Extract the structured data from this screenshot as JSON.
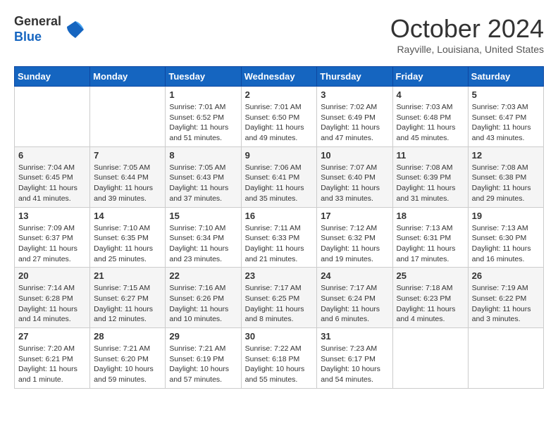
{
  "logo": {
    "general": "General",
    "blue": "Blue"
  },
  "header": {
    "month_title": "October 2024",
    "location": "Rayville, Louisiana, United States"
  },
  "weekdays": [
    "Sunday",
    "Monday",
    "Tuesday",
    "Wednesday",
    "Thursday",
    "Friday",
    "Saturday"
  ],
  "weeks": [
    [
      {
        "day": "",
        "info": ""
      },
      {
        "day": "",
        "info": ""
      },
      {
        "day": "1",
        "info": "Sunrise: 7:01 AM\nSunset: 6:52 PM\nDaylight: 11 hours and 51 minutes."
      },
      {
        "day": "2",
        "info": "Sunrise: 7:01 AM\nSunset: 6:50 PM\nDaylight: 11 hours and 49 minutes."
      },
      {
        "day": "3",
        "info": "Sunrise: 7:02 AM\nSunset: 6:49 PM\nDaylight: 11 hours and 47 minutes."
      },
      {
        "day": "4",
        "info": "Sunrise: 7:03 AM\nSunset: 6:48 PM\nDaylight: 11 hours and 45 minutes."
      },
      {
        "day": "5",
        "info": "Sunrise: 7:03 AM\nSunset: 6:47 PM\nDaylight: 11 hours and 43 minutes."
      }
    ],
    [
      {
        "day": "6",
        "info": "Sunrise: 7:04 AM\nSunset: 6:45 PM\nDaylight: 11 hours and 41 minutes."
      },
      {
        "day": "7",
        "info": "Sunrise: 7:05 AM\nSunset: 6:44 PM\nDaylight: 11 hours and 39 minutes."
      },
      {
        "day": "8",
        "info": "Sunrise: 7:05 AM\nSunset: 6:43 PM\nDaylight: 11 hours and 37 minutes."
      },
      {
        "day": "9",
        "info": "Sunrise: 7:06 AM\nSunset: 6:41 PM\nDaylight: 11 hours and 35 minutes."
      },
      {
        "day": "10",
        "info": "Sunrise: 7:07 AM\nSunset: 6:40 PM\nDaylight: 11 hours and 33 minutes."
      },
      {
        "day": "11",
        "info": "Sunrise: 7:08 AM\nSunset: 6:39 PM\nDaylight: 11 hours and 31 minutes."
      },
      {
        "day": "12",
        "info": "Sunrise: 7:08 AM\nSunset: 6:38 PM\nDaylight: 11 hours and 29 minutes."
      }
    ],
    [
      {
        "day": "13",
        "info": "Sunrise: 7:09 AM\nSunset: 6:37 PM\nDaylight: 11 hours and 27 minutes."
      },
      {
        "day": "14",
        "info": "Sunrise: 7:10 AM\nSunset: 6:35 PM\nDaylight: 11 hours and 25 minutes."
      },
      {
        "day": "15",
        "info": "Sunrise: 7:10 AM\nSunset: 6:34 PM\nDaylight: 11 hours and 23 minutes."
      },
      {
        "day": "16",
        "info": "Sunrise: 7:11 AM\nSunset: 6:33 PM\nDaylight: 11 hours and 21 minutes."
      },
      {
        "day": "17",
        "info": "Sunrise: 7:12 AM\nSunset: 6:32 PM\nDaylight: 11 hours and 19 minutes."
      },
      {
        "day": "18",
        "info": "Sunrise: 7:13 AM\nSunset: 6:31 PM\nDaylight: 11 hours and 17 minutes."
      },
      {
        "day": "19",
        "info": "Sunrise: 7:13 AM\nSunset: 6:30 PM\nDaylight: 11 hours and 16 minutes."
      }
    ],
    [
      {
        "day": "20",
        "info": "Sunrise: 7:14 AM\nSunset: 6:28 PM\nDaylight: 11 hours and 14 minutes."
      },
      {
        "day": "21",
        "info": "Sunrise: 7:15 AM\nSunset: 6:27 PM\nDaylight: 11 hours and 12 minutes."
      },
      {
        "day": "22",
        "info": "Sunrise: 7:16 AM\nSunset: 6:26 PM\nDaylight: 11 hours and 10 minutes."
      },
      {
        "day": "23",
        "info": "Sunrise: 7:17 AM\nSunset: 6:25 PM\nDaylight: 11 hours and 8 minutes."
      },
      {
        "day": "24",
        "info": "Sunrise: 7:17 AM\nSunset: 6:24 PM\nDaylight: 11 hours and 6 minutes."
      },
      {
        "day": "25",
        "info": "Sunrise: 7:18 AM\nSunset: 6:23 PM\nDaylight: 11 hours and 4 minutes."
      },
      {
        "day": "26",
        "info": "Sunrise: 7:19 AM\nSunset: 6:22 PM\nDaylight: 11 hours and 3 minutes."
      }
    ],
    [
      {
        "day": "27",
        "info": "Sunrise: 7:20 AM\nSunset: 6:21 PM\nDaylight: 11 hours and 1 minute."
      },
      {
        "day": "28",
        "info": "Sunrise: 7:21 AM\nSunset: 6:20 PM\nDaylight: 10 hours and 59 minutes."
      },
      {
        "day": "29",
        "info": "Sunrise: 7:21 AM\nSunset: 6:19 PM\nDaylight: 10 hours and 57 minutes."
      },
      {
        "day": "30",
        "info": "Sunrise: 7:22 AM\nSunset: 6:18 PM\nDaylight: 10 hours and 55 minutes."
      },
      {
        "day": "31",
        "info": "Sunrise: 7:23 AM\nSunset: 6:17 PM\nDaylight: 10 hours and 54 minutes."
      },
      {
        "day": "",
        "info": ""
      },
      {
        "day": "",
        "info": ""
      }
    ]
  ]
}
